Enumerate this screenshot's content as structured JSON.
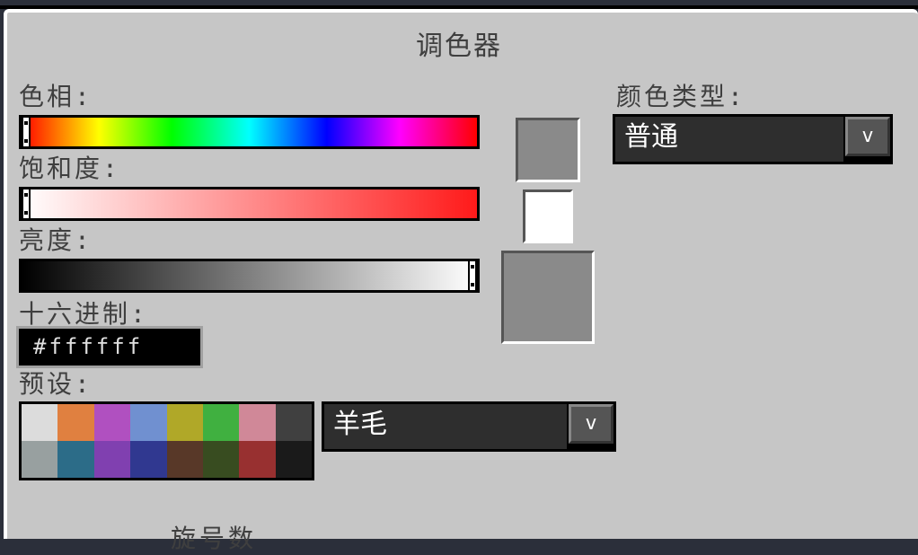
{
  "dialog": {
    "title": "调色器"
  },
  "hue": {
    "label": "色相:",
    "value_fraction": 0.0
  },
  "saturation": {
    "label": "饱和度:",
    "value_fraction": 0.0
  },
  "brightness": {
    "label": "亮度:",
    "value_fraction": 1.0
  },
  "hex": {
    "label": "十六进制:",
    "value": "#ffffff"
  },
  "presets": {
    "label": "预设:",
    "colors": [
      "#dcdcdc",
      "#e08040",
      "#b050c0",
      "#7090d0",
      "#b0a828",
      "#40b040",
      "#d08898",
      "#404040",
      "#98a0a0",
      "#2c6c88",
      "#8040b0",
      "#303890",
      "#583828",
      "#384c20",
      "#983030",
      "#1a1a1a"
    ],
    "dropdown": {
      "selected": "羊毛",
      "button_label": "v"
    }
  },
  "color_type": {
    "label": "颜色类型:",
    "selected": "普通",
    "button_label": "v"
  },
  "previews": {
    "top_color": "#8a8a8a",
    "middle_color": "#ffffff",
    "bottom_color": "#8a8a8a"
  },
  "footer": {
    "partial_label": "旋号数"
  }
}
